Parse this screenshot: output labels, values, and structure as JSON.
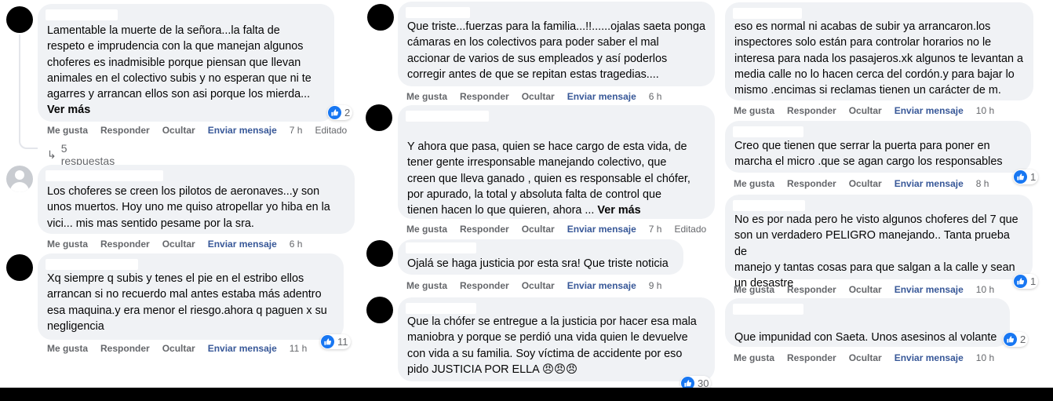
{
  "actions": {
    "like": "Me gusta",
    "reply": "Responder",
    "hide": "Ocultar",
    "send_message": "Enviar mensaje",
    "edited": "Editado"
  },
  "comments": [
    {
      "text": "Lamentable la muerte de la señora...la falta de\nrespeto e imprudencia con la que manejan algunos\nchoferes es inadmisible porque piensan que llevan\nanimales en el colectivo subis y no esperan que ni te\nagarres y arrancan ellos son asi porque los mierda...",
      "see_more": "Ver más",
      "reactions": "2",
      "time": "7 h",
      "replies": "5 respuestas"
    },
    {
      "text": "Los choferes se creen los pilotos de aeronaves...y son\nunos muertos. Hoy uno me quiso atropellar yo hiba en la\nvici... mis mas sentido pesame por la sra.",
      "time": "6 h"
    },
    {
      "text": "Xq siempre q subis y tenes el pie en el estribo ellos\narrancan si no recuerdo mal antes estaba más adentro\nesa maquina.y era menor el riesgo.ahora q paguen x su\nnegligencia",
      "reactions": "11",
      "time": "11 h"
    },
    {
      "text": "Que triste...fuerzas para la familia...!!......ojalas saeta ponga\ncámaras en los colectivos para poder saber el mal\naccionar de varios de sus empleados y así poderlos\ncorregir antes de que se repitan estas tragedias....",
      "time": "6 h"
    },
    {
      "text": "Y ahora que pasa, quien se hace cargo de esta vida, de\ntener gente irresponsable manejando colectivo, que\ncreen que lleva ganado , quien es responsable el chófer,\npor apurado, la total y absoluta falta de control que\ntienen hacen lo que quieren, ahora ... ",
      "see_more": "Ver más",
      "time": "7 h"
    },
    {
      "text": "Ojalá se haga justicia por esta sra! Que triste noticia",
      "time": "9 h"
    },
    {
      "text": "Que la chófer se entregue a la justicia por hacer esa mala\nmaniobra y porque se perdió una vida quien le devuelve\ncon vida a su familia. Soy víctima de accidente por eso\npido JUSTICIA POR ELLA 😠😠😠",
      "reactions": "30"
    },
    {
      "text": "eso es normal ni acabas de subir ya arrancaron.los\ninspectores solo están para controlar horarios no le\ninteresa para nada los pasajeros.xk algunos te levantan a\nmedia calle no lo hacen cerca del cordón.y para bajar lo\nmismo .encimas si reclamas tienen un carácter de m.",
      "time": "10 h"
    },
    {
      "text": "Creo que tienen que serrar la puerta para poner en\nmarcha el micro .que se agan cargo los responsables",
      "reactions": "1",
      "time": "8 h"
    },
    {
      "text": "No es por nada pero he visto algunos choferes del 7 que\nson un verdadero PELIGRO manejando.. Tanta prueba de\nmanejo y tantas cosas para que salgan a la calle y sean\nun desastre",
      "reactions": "1",
      "time": "10 h"
    },
    {
      "text": "Que impunidad con Saeta. Unos asesinos al volante",
      "reactions": "2",
      "time": "10 h"
    }
  ]
}
